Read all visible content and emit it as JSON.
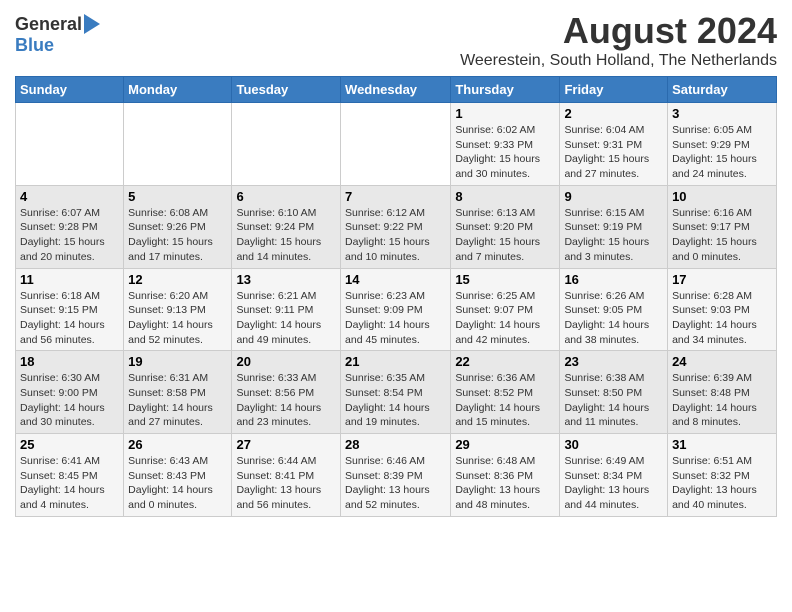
{
  "header": {
    "logo_general": "General",
    "logo_blue": "Blue",
    "month_year": "August 2024",
    "location": "Weerestein, South Holland, The Netherlands"
  },
  "weekdays": [
    "Sunday",
    "Monday",
    "Tuesday",
    "Wednesday",
    "Thursday",
    "Friday",
    "Saturday"
  ],
  "weeks": [
    [
      {
        "day": "",
        "info": ""
      },
      {
        "day": "",
        "info": ""
      },
      {
        "day": "",
        "info": ""
      },
      {
        "day": "",
        "info": ""
      },
      {
        "day": "1",
        "info": "Sunrise: 6:02 AM\nSunset: 9:33 PM\nDaylight: 15 hours\nand 30 minutes."
      },
      {
        "day": "2",
        "info": "Sunrise: 6:04 AM\nSunset: 9:31 PM\nDaylight: 15 hours\nand 27 minutes."
      },
      {
        "day": "3",
        "info": "Sunrise: 6:05 AM\nSunset: 9:29 PM\nDaylight: 15 hours\nand 24 minutes."
      }
    ],
    [
      {
        "day": "4",
        "info": "Sunrise: 6:07 AM\nSunset: 9:28 PM\nDaylight: 15 hours\nand 20 minutes."
      },
      {
        "day": "5",
        "info": "Sunrise: 6:08 AM\nSunset: 9:26 PM\nDaylight: 15 hours\nand 17 minutes."
      },
      {
        "day": "6",
        "info": "Sunrise: 6:10 AM\nSunset: 9:24 PM\nDaylight: 15 hours\nand 14 minutes."
      },
      {
        "day": "7",
        "info": "Sunrise: 6:12 AM\nSunset: 9:22 PM\nDaylight: 15 hours\nand 10 minutes."
      },
      {
        "day": "8",
        "info": "Sunrise: 6:13 AM\nSunset: 9:20 PM\nDaylight: 15 hours\nand 7 minutes."
      },
      {
        "day": "9",
        "info": "Sunrise: 6:15 AM\nSunset: 9:19 PM\nDaylight: 15 hours\nand 3 minutes."
      },
      {
        "day": "10",
        "info": "Sunrise: 6:16 AM\nSunset: 9:17 PM\nDaylight: 15 hours\nand 0 minutes."
      }
    ],
    [
      {
        "day": "11",
        "info": "Sunrise: 6:18 AM\nSunset: 9:15 PM\nDaylight: 14 hours\nand 56 minutes."
      },
      {
        "day": "12",
        "info": "Sunrise: 6:20 AM\nSunset: 9:13 PM\nDaylight: 14 hours\nand 52 minutes."
      },
      {
        "day": "13",
        "info": "Sunrise: 6:21 AM\nSunset: 9:11 PM\nDaylight: 14 hours\nand 49 minutes."
      },
      {
        "day": "14",
        "info": "Sunrise: 6:23 AM\nSunset: 9:09 PM\nDaylight: 14 hours\nand 45 minutes."
      },
      {
        "day": "15",
        "info": "Sunrise: 6:25 AM\nSunset: 9:07 PM\nDaylight: 14 hours\nand 42 minutes."
      },
      {
        "day": "16",
        "info": "Sunrise: 6:26 AM\nSunset: 9:05 PM\nDaylight: 14 hours\nand 38 minutes."
      },
      {
        "day": "17",
        "info": "Sunrise: 6:28 AM\nSunset: 9:03 PM\nDaylight: 14 hours\nand 34 minutes."
      }
    ],
    [
      {
        "day": "18",
        "info": "Sunrise: 6:30 AM\nSunset: 9:00 PM\nDaylight: 14 hours\nand 30 minutes."
      },
      {
        "day": "19",
        "info": "Sunrise: 6:31 AM\nSunset: 8:58 PM\nDaylight: 14 hours\nand 27 minutes."
      },
      {
        "day": "20",
        "info": "Sunrise: 6:33 AM\nSunset: 8:56 PM\nDaylight: 14 hours\nand 23 minutes."
      },
      {
        "day": "21",
        "info": "Sunrise: 6:35 AM\nSunset: 8:54 PM\nDaylight: 14 hours\nand 19 minutes."
      },
      {
        "day": "22",
        "info": "Sunrise: 6:36 AM\nSunset: 8:52 PM\nDaylight: 14 hours\nand 15 minutes."
      },
      {
        "day": "23",
        "info": "Sunrise: 6:38 AM\nSunset: 8:50 PM\nDaylight: 14 hours\nand 11 minutes."
      },
      {
        "day": "24",
        "info": "Sunrise: 6:39 AM\nSunset: 8:48 PM\nDaylight: 14 hours\nand 8 minutes."
      }
    ],
    [
      {
        "day": "25",
        "info": "Sunrise: 6:41 AM\nSunset: 8:45 PM\nDaylight: 14 hours\nand 4 minutes."
      },
      {
        "day": "26",
        "info": "Sunrise: 6:43 AM\nSunset: 8:43 PM\nDaylight: 14 hours\nand 0 minutes."
      },
      {
        "day": "27",
        "info": "Sunrise: 6:44 AM\nSunset: 8:41 PM\nDaylight: 13 hours\nand 56 minutes."
      },
      {
        "day": "28",
        "info": "Sunrise: 6:46 AM\nSunset: 8:39 PM\nDaylight: 13 hours\nand 52 minutes."
      },
      {
        "day": "29",
        "info": "Sunrise: 6:48 AM\nSunset: 8:36 PM\nDaylight: 13 hours\nand 48 minutes."
      },
      {
        "day": "30",
        "info": "Sunrise: 6:49 AM\nSunset: 8:34 PM\nDaylight: 13 hours\nand 44 minutes."
      },
      {
        "day": "31",
        "info": "Sunrise: 6:51 AM\nSunset: 8:32 PM\nDaylight: 13 hours\nand 40 minutes."
      }
    ]
  ]
}
